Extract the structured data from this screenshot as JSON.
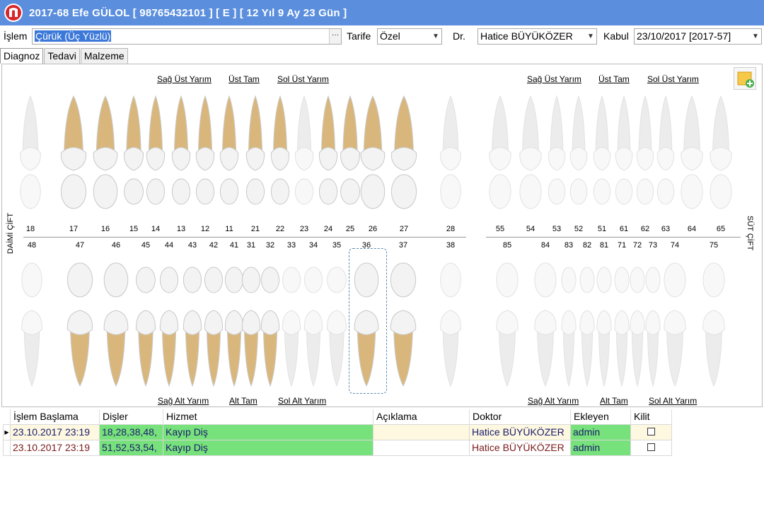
{
  "window": {
    "title": "2017-68 Efe GÜLOL [ 98765432101 ] [ E ] [ 12 Yıl 9 Ay 23 Gün ]"
  },
  "form": {
    "islem_label": "İşlem",
    "islem_value": "Çürük (Üç Yüzlü)",
    "dots": "···",
    "tarife_label": "Tarife",
    "tarife_value": "Özel",
    "dr_label": "Dr.",
    "dr_value": "Hatice BÜYÜKÖZER",
    "kabul_label": "Kabul",
    "kabul_value": "23/10/2017 [2017-57]"
  },
  "tabs": [
    "Diagnoz",
    "Tedavi",
    "Malzeme"
  ],
  "chart": {
    "permanent": {
      "upper_links": [
        "Sağ Üst Yarım",
        "Üst Tam",
        "Sol Üst Yarım"
      ],
      "lower_links": [
        "Sağ Alt Yarım",
        "Alt Tam",
        "Sol Alt Yarım"
      ],
      "upper_numbers": [
        "18",
        "17",
        "16",
        "15",
        "14",
        "13",
        "12",
        "11",
        "21",
        "22",
        "23",
        "24",
        "25",
        "26",
        "27",
        "28"
      ],
      "lower_numbers": [
        "48",
        "47",
        "46",
        "45",
        "44",
        "43",
        "42",
        "41",
        "31",
        "32",
        "33",
        "34",
        "35",
        "36",
        "37",
        "38"
      ],
      "side_label": "DAİMİ ÇİFT"
    },
    "primary": {
      "upper_links": [
        "Sağ Üst Yarım",
        "Üst Tam",
        "Sol Üst Yarım"
      ],
      "lower_links": [
        "Sağ Alt Yarım",
        "Alt Tam",
        "Sol Alt Yarım"
      ],
      "upper_numbers": [
        "55",
        "54",
        "53",
        "52",
        "51",
        "61",
        "62",
        "63",
        "64",
        "65"
      ],
      "lower_numbers": [
        "85",
        "84",
        "83",
        "82",
        "81",
        "71",
        "72",
        "73",
        "74",
        "75"
      ],
      "side_label": "SÜT ÇİFT"
    },
    "colors": {
      "root": "#d9b77c",
      "crown": "#f3f3f3",
      "missing": "#ececec",
      "selection": "#5b8fb8"
    }
  },
  "grid": {
    "columns": [
      "İşlem Başlama",
      "Dişler",
      "Hizmet",
      "Açıklama",
      "Doktor",
      "Ekleyen",
      "Kilit"
    ],
    "rows": [
      {
        "start": "23.10.2017 23:19",
        "teeth": "18,28,38,48,",
        "service": "Kayıp Diş",
        "note": "",
        "doctor": "Hatice BÜYÜKÖZER",
        "by": "admin"
      },
      {
        "start": "23.10.2017 23:19",
        "teeth": "51,52,53,54,",
        "service": "Kayıp Diş",
        "note": "",
        "doctor": "Hatice BÜYÜKÖZER",
        "by": "admin"
      }
    ]
  }
}
